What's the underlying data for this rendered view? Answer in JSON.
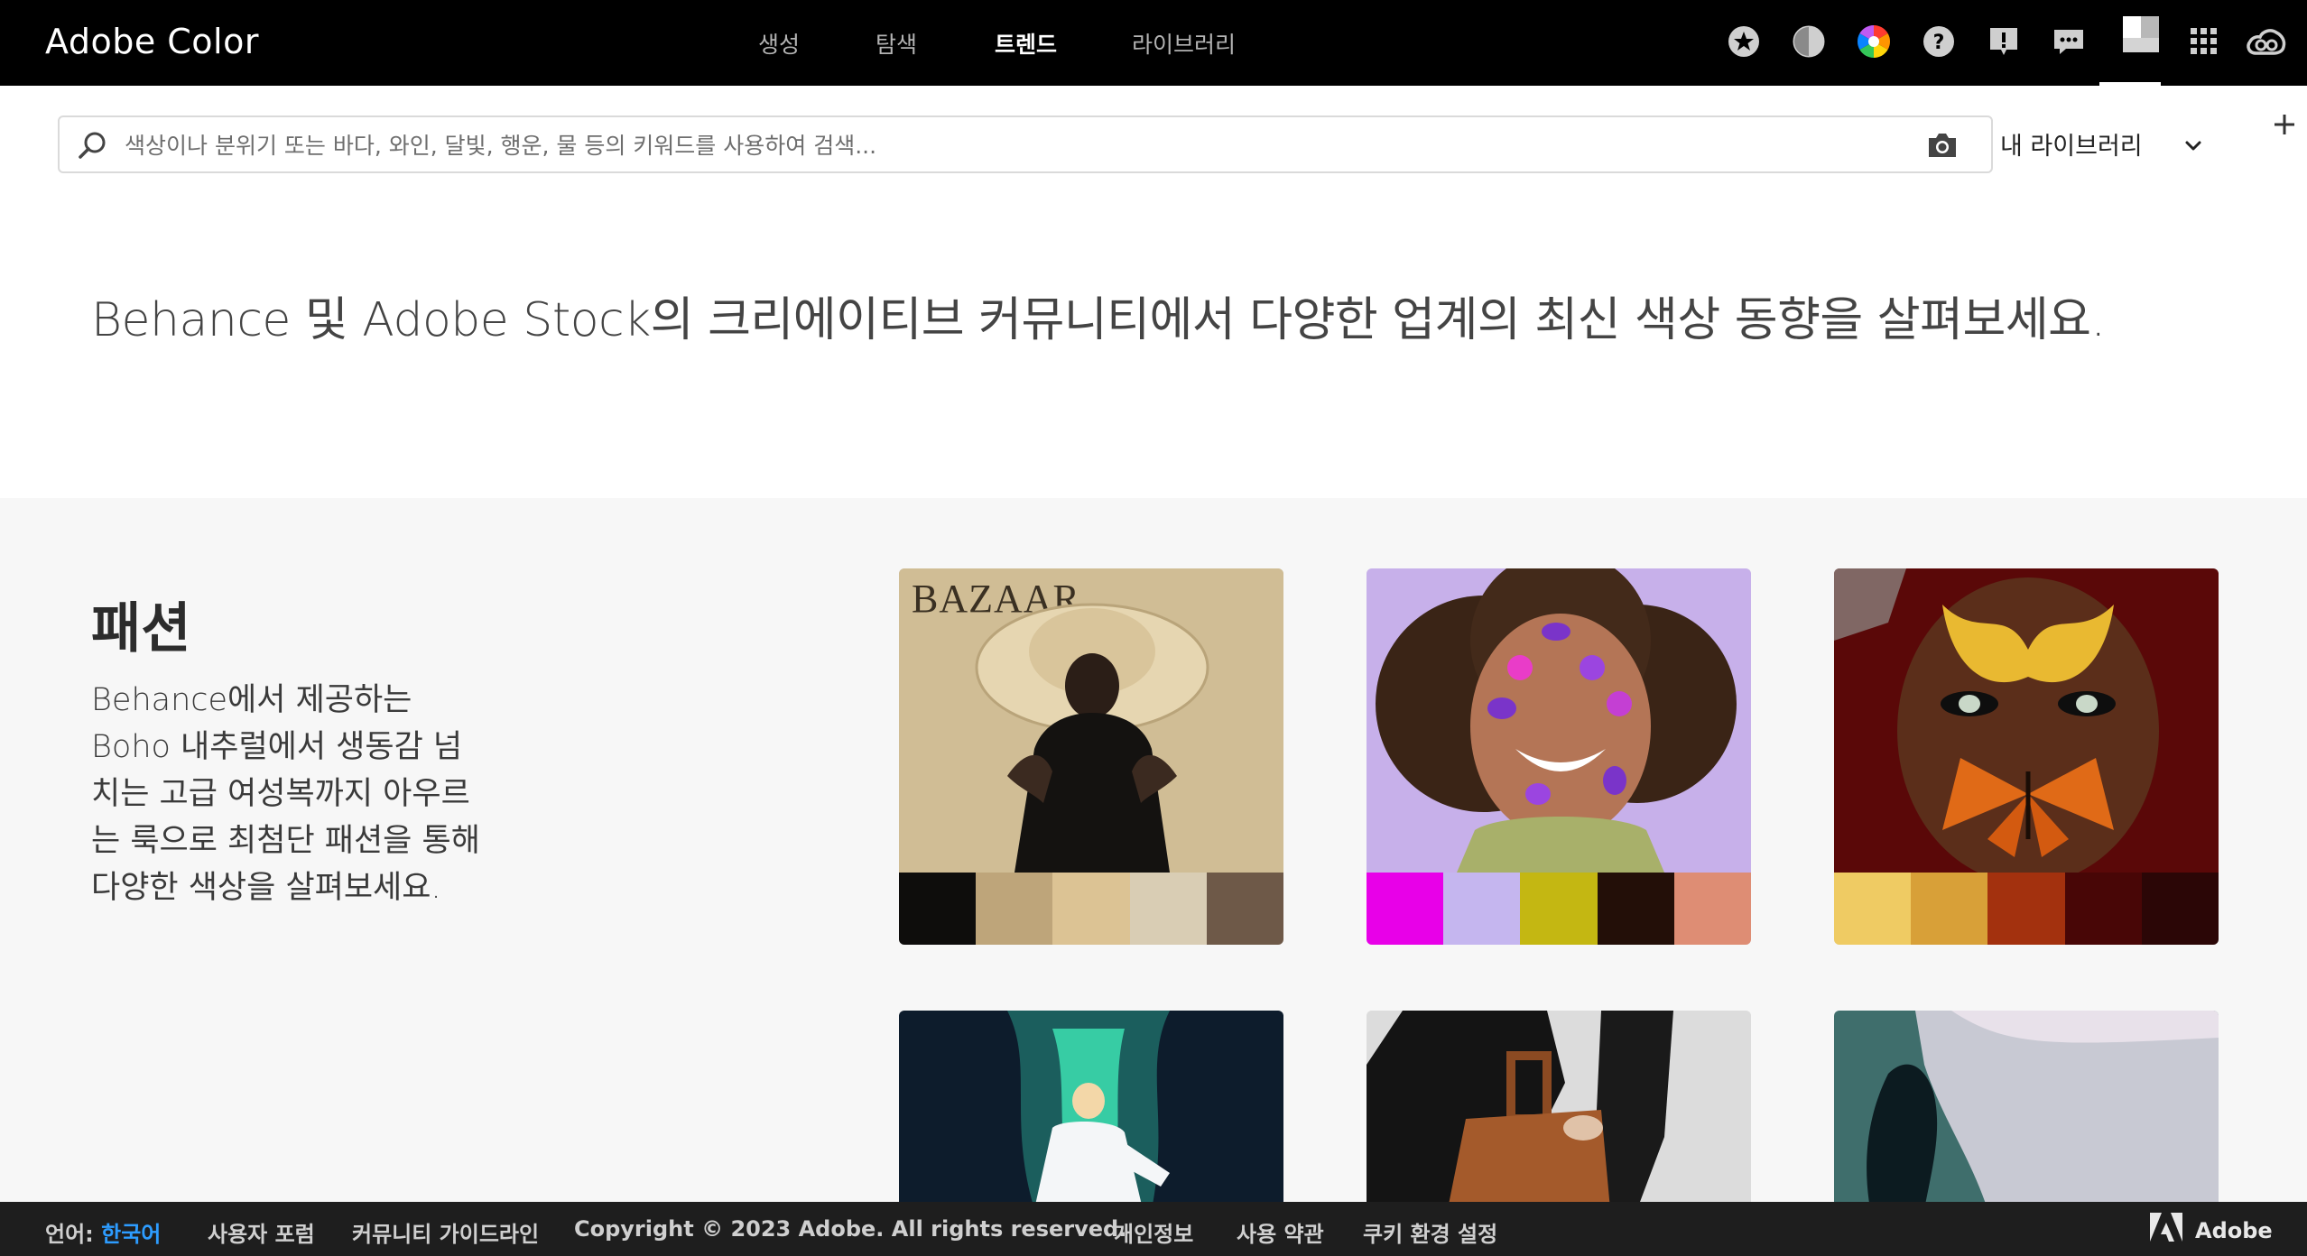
{
  "header": {
    "brand": "Adobe Color",
    "nav": [
      {
        "label": "생성",
        "active": false
      },
      {
        "label": "탐색",
        "active": false
      },
      {
        "label": "트렌드",
        "active": true
      },
      {
        "label": "라이브러리",
        "active": false
      }
    ],
    "toolbar_icons": [
      "star-icon",
      "contrast-icon",
      "color-wheel-icon",
      "help-icon",
      "feedback-icon",
      "chat-icon",
      "profile-avatar",
      "app-grid-icon",
      "creative-cloud-icon"
    ]
  },
  "search": {
    "placeholder": "색상이나 분위기 또는 바다, 와인, 달빛, 행운, 물 등의 키워드를 사용하여 검색...",
    "value": "",
    "library_label": "내 라이브러리"
  },
  "headline": "Behance 및 Adobe Stock의 크리에이티브 커뮤니티에서 다양한 업계의 최신 색상 동향을 살펴보세요.",
  "fashion": {
    "title": "패션",
    "description": "Behance에서 제공하는 Boho 내추럴에서 생동감 넘치는 고급 여성복까지 아우르는 룩으로 최첨단 패션을 통해 다양한 색상을 살펴보세요.",
    "cards": [
      {
        "photo_label": "BAZAAR",
        "swatches": [
          "#0e0d0c",
          "#bea57a",
          "#dcc394",
          "#d9cdb4",
          "#6e5948"
        ]
      },
      {
        "photo_label": "",
        "swatches": [
          "#e800e8",
          "#c5b6ef",
          "#c4b712",
          "#230f08",
          "#de8d74"
        ]
      },
      {
        "photo_label": "",
        "swatches": [
          "#efcb63",
          "#d8a038",
          "#a3310e",
          "#480606",
          "#2b0606"
        ]
      },
      {
        "photo_label": "",
        "swatches": []
      },
      {
        "photo_label": "",
        "swatches": []
      },
      {
        "photo_label": "",
        "swatches": []
      }
    ]
  },
  "footer": {
    "language_label": "언어:",
    "language_value": "한국어",
    "links": [
      "사용자 포럼",
      "커뮤니티 가이드라인",
      "Copyright © 2023 Adobe. All rights reserved.",
      "개인정보",
      "사용 약관",
      "쿠키 환경 설정"
    ],
    "brand": "Adobe"
  }
}
